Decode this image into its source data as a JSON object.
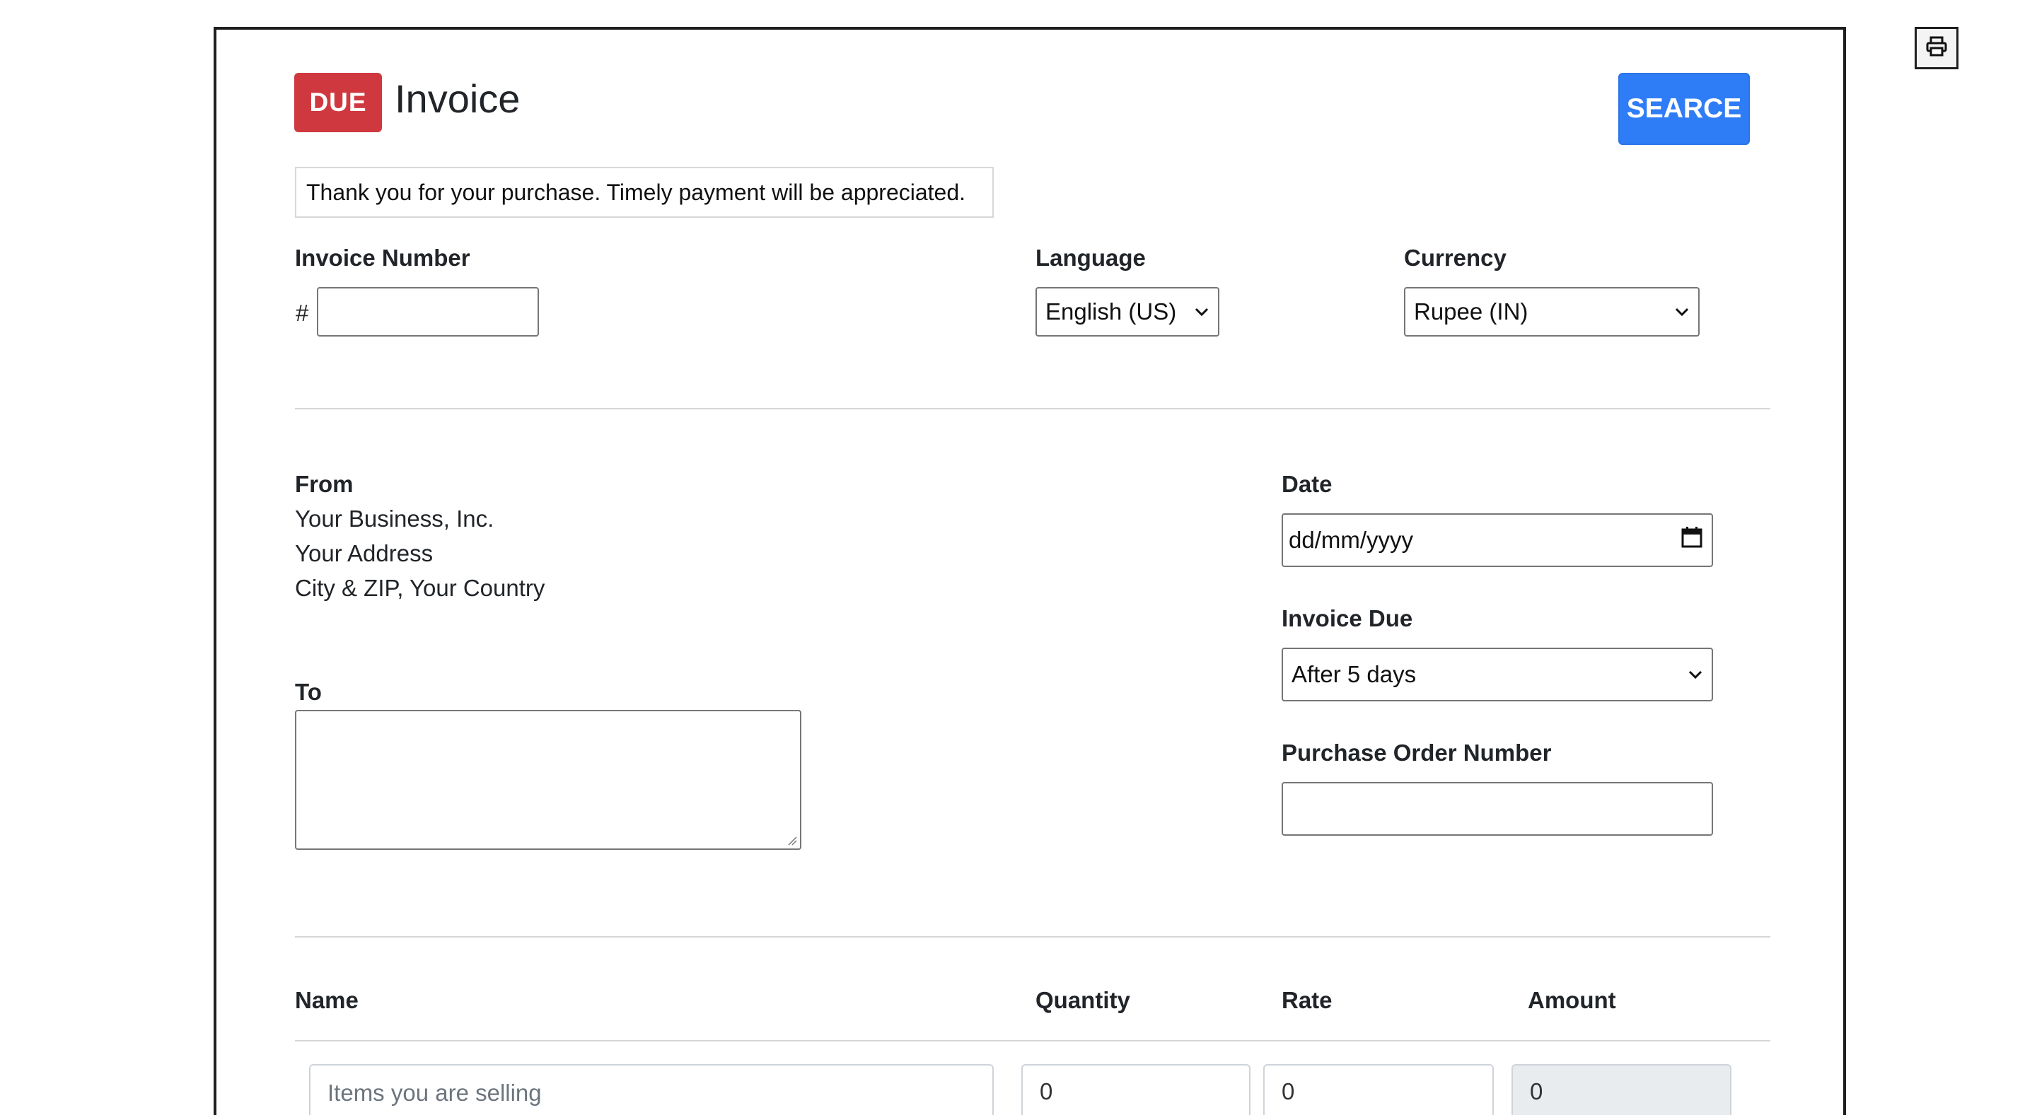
{
  "header": {
    "badge": "DUE",
    "title": "Invoice",
    "search_label": "SEARCE",
    "note": "Thank you for your purchase. Timely payment will be appreciated."
  },
  "fields": {
    "invoice_number_label": "Invoice Number",
    "invoice_number_prefix": "#",
    "invoice_number_value": "",
    "language_label": "Language",
    "language_value": "English (US)",
    "currency_label": "Currency",
    "currency_value": "Rupee (IN)"
  },
  "from": {
    "label": "From",
    "lines": [
      "Your Business, Inc.",
      "Your Address",
      "City & ZIP, Your Country"
    ]
  },
  "to": {
    "label": "To",
    "value": ""
  },
  "meta": {
    "date_label": "Date",
    "date_placeholder": "dd/mm/yyyy",
    "invoice_due_label": "Invoice Due",
    "invoice_due_value": "After 5 days",
    "po_label": "Purchase Order Number",
    "po_value": ""
  },
  "items": {
    "headers": {
      "name": "Name",
      "quantity": "Quantity",
      "rate": "Rate",
      "amount": "Amount"
    },
    "rows": [
      {
        "name_placeholder": "Items you are selling",
        "quantity": "0",
        "rate": "0",
        "amount": "0"
      }
    ]
  },
  "icons": {
    "print": "printer-icon",
    "calendar": "calendar-icon",
    "select": "chevron-down-icon"
  },
  "colors": {
    "due_badge": "#d0383f",
    "search_button": "#2f7df6",
    "frame_border": "#1f1f1f"
  }
}
